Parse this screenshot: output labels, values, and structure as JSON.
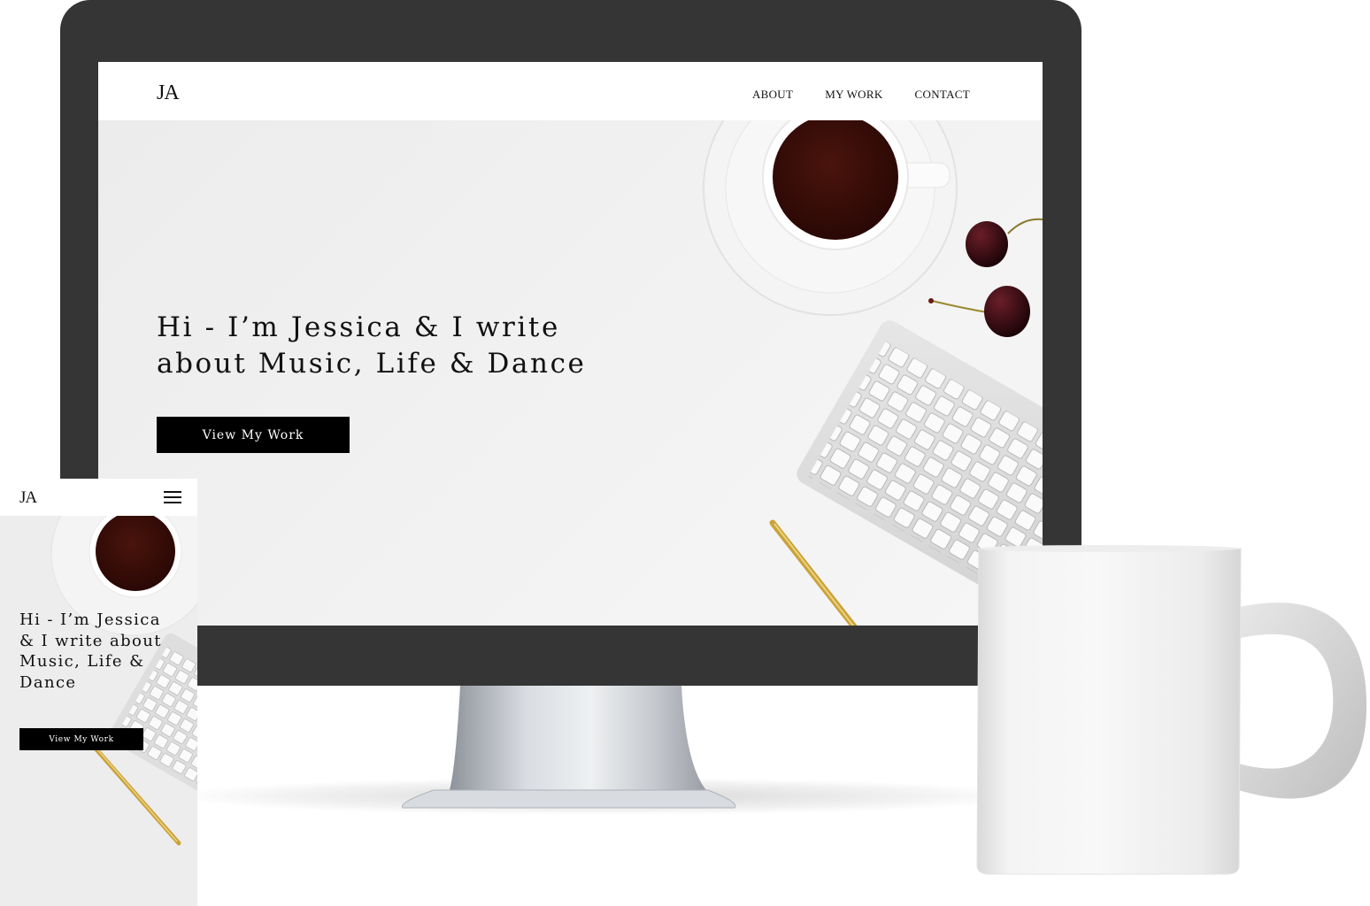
{
  "desktop": {
    "logo": "JA",
    "nav": [
      {
        "label": "ABOUT"
      },
      {
        "label": "MY WORK"
      },
      {
        "label": "CONTACT"
      }
    ],
    "hero": {
      "title": "Hi - I’m Jessica & I write about Music, Life & Dance",
      "button_label": "View My Work"
    }
  },
  "mobile": {
    "logo": "JA",
    "hero": {
      "title": "Hi - I’m Jessica & I write about Music, Life & Dance",
      "button_label": "View My Work"
    }
  },
  "icons": {
    "menu": "hamburger-menu-icon"
  },
  "colors": {
    "bezel": "#353535",
    "button_background": "#000000",
    "button_text": "#ffffff",
    "hero_background": "#eeeeee",
    "coffee": "#3a0e08"
  }
}
